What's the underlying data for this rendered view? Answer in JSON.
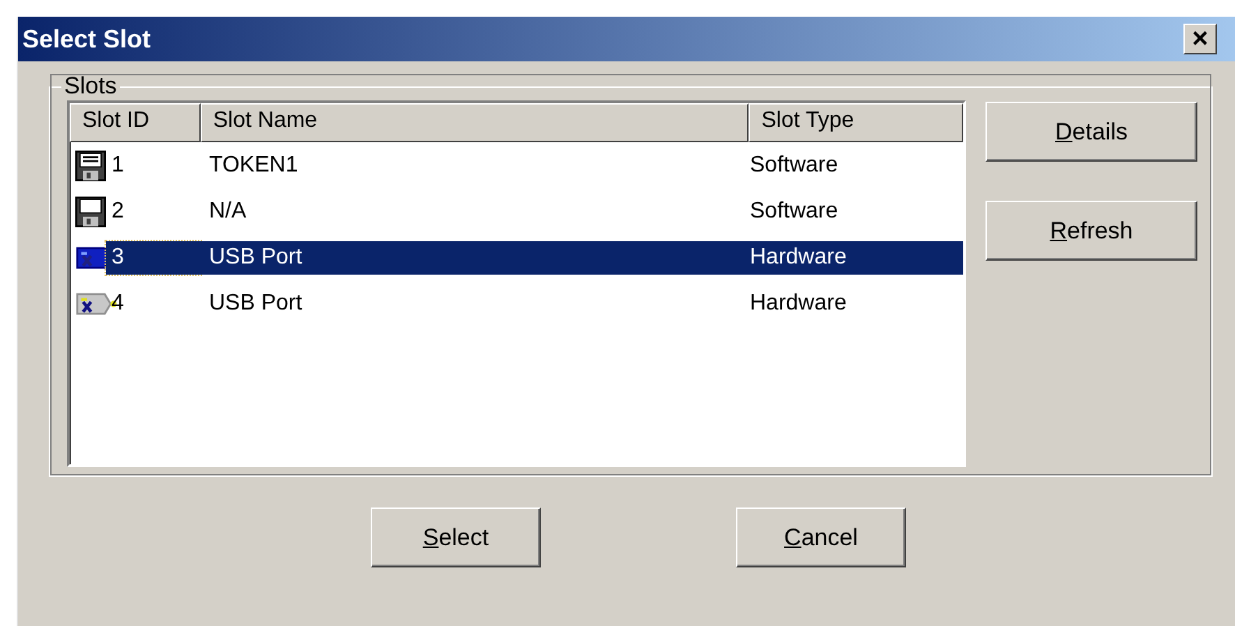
{
  "window": {
    "title": "Select Slot",
    "close": "×"
  },
  "group": {
    "label": "Slots"
  },
  "table": {
    "columns": [
      "Slot ID",
      "Slot Name",
      "Slot Type"
    ],
    "rows": [
      {
        "kind": "software-token",
        "id": "1",
        "name": "TOKEN1",
        "type": "Software",
        "selected": false
      },
      {
        "kind": "software-empty",
        "id": "2",
        "name": "N/A",
        "type": "Software",
        "selected": false
      },
      {
        "kind": "hardware",
        "id": "3",
        "name": "USB Port",
        "type": "Hardware",
        "selected": true
      },
      {
        "kind": "hardware",
        "id": "4",
        "name": "USB Port",
        "type": "Hardware",
        "selected": false
      }
    ]
  },
  "side_buttons": [
    {
      "label": "Details"
    },
    {
      "label": "Refresh"
    }
  ],
  "bottom_buttons": [
    {
      "label": "Select"
    },
    {
      "label": "Cancel"
    }
  ]
}
